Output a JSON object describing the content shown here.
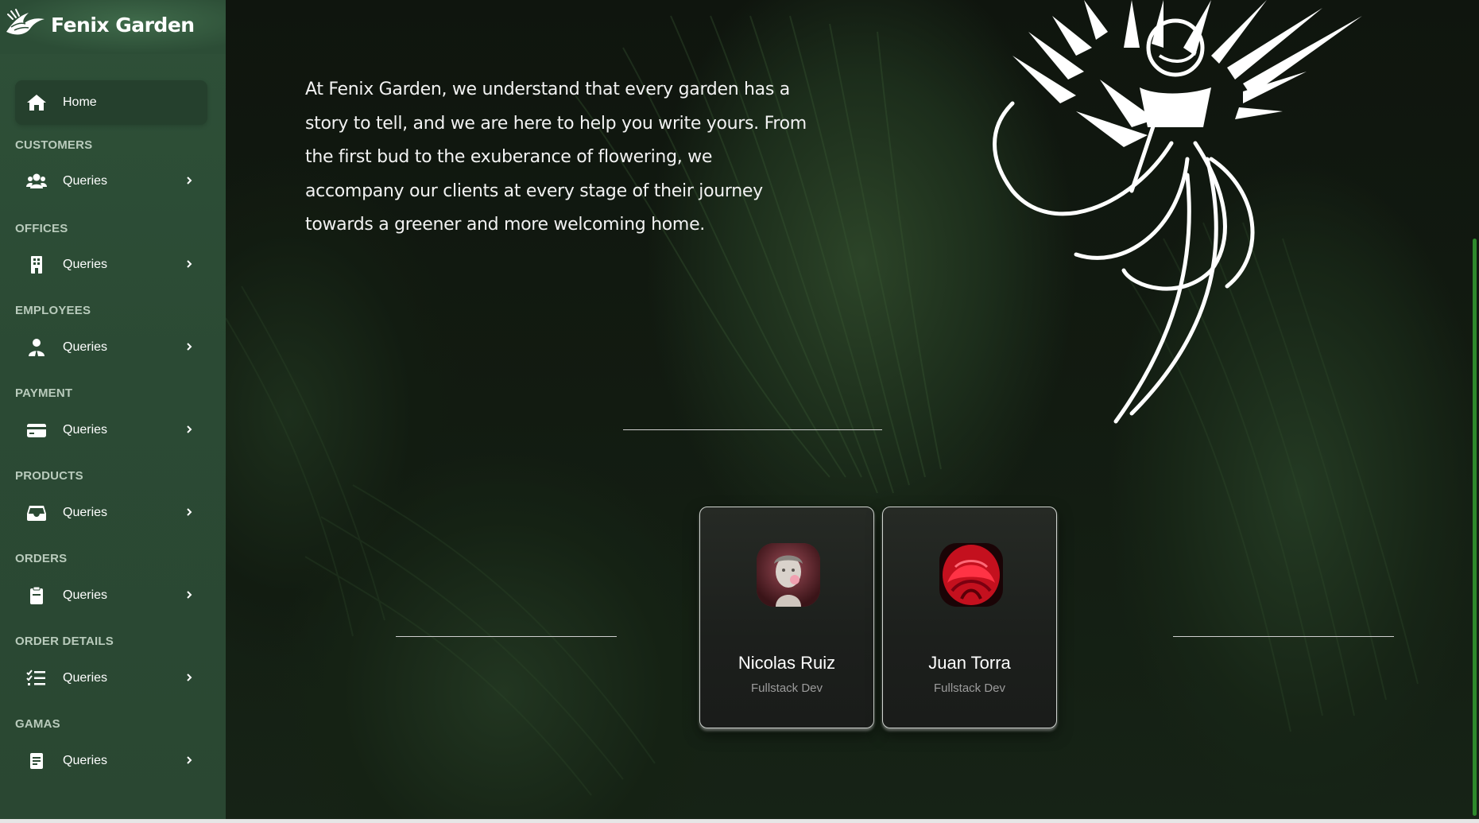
{
  "brand": {
    "name": "Fenix Garden",
    "logo_icon": "phoenix-logo-icon"
  },
  "sidebar": {
    "home": {
      "label": "Home",
      "icon": "home-icon"
    },
    "sections": [
      {
        "title": "CUSTOMERS",
        "item": "Queries",
        "icon": "users-icon"
      },
      {
        "title": "OFFICES",
        "item": "Queries",
        "icon": "building-icon"
      },
      {
        "title": "EMPLOYEES",
        "item": "Queries",
        "icon": "user-icon"
      },
      {
        "title": "PAYMENT",
        "item": "Queries",
        "icon": "credit-card-icon"
      },
      {
        "title": "PRODUCTS",
        "item": "Queries",
        "icon": "inbox-icon"
      },
      {
        "title": "ORDERS",
        "item": "Queries",
        "icon": "clipboard-icon"
      },
      {
        "title": "ORDER DETAILS",
        "item": "Queries",
        "icon": "list-check-icon"
      },
      {
        "title": "GAMAS",
        "item": "Queries",
        "icon": "file-list-icon"
      }
    ],
    "colors": {
      "background": "#2b4a34",
      "active": "#25402d",
      "section_title": "#b9cbbc"
    }
  },
  "main": {
    "about": "At Fenix Garden, we understand that every garden has a story to tell, and we are here to help you write yours. From the first bud to the exuberance of flowering, we accompany our clients at every stage of their journey towards a greener and more welcoming home.",
    "team": [
      {
        "name": "Nicolas Ruiz",
        "role": "Fullstack Dev",
        "avatar": "statue-avatar"
      },
      {
        "name": "Juan Torra",
        "role": "Fullstack Dev",
        "avatar": "red-mask-avatar"
      }
    ],
    "colors": {
      "scroll_thumb": "#2e8a2c",
      "card_border": "#cfd3cf"
    }
  }
}
